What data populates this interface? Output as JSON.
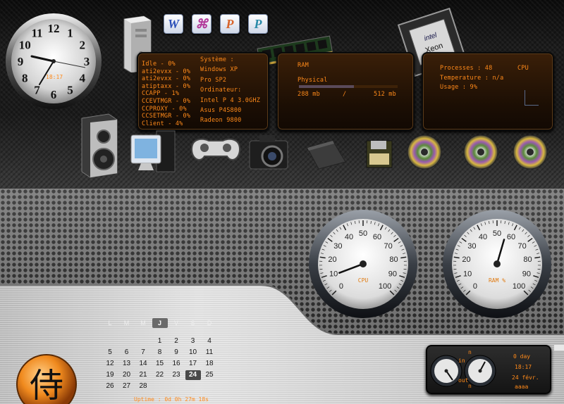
{
  "clock": {
    "time": "18:17",
    "numerals": [
      "12",
      "1",
      "2",
      "3",
      "4",
      "5",
      "6",
      "7",
      "8",
      "9",
      "10",
      "11"
    ]
  },
  "system_panel": {
    "processes": [
      "Idle - 0%",
      "ati2evxx - 0%",
      "ati2evxx - 0%",
      "atiptaxx - 0%",
      "CCAPP - 1%",
      "CCEVTMGR - 0%",
      "CCPROXY - 0%",
      "CCSETMGR - 0%",
      "Client - 4%"
    ],
    "system_info": [
      "Système :",
      "Windows XP",
      "Pro SP2",
      "Ordinateur:",
      "Intel P 4 3.0GHZ",
      "Asus P4S800",
      "Radeon 9800"
    ]
  },
  "ram_panel": {
    "title": "RAM",
    "label": "Physical",
    "used": "288 mb",
    "separator": "/",
    "total": "512 mb",
    "usage_fraction": 0.56
  },
  "cpu_panel": {
    "title": "CPU",
    "processes": "Processes : 48",
    "temperature": "Temperature : n/a",
    "usage": "Usage : 9%",
    "chip_brand": "intel",
    "chip_model": "Xeon"
  },
  "launcher": {
    "office_icons": [
      {
        "name": "word-icon",
        "glyph": "W",
        "color": "#2a4fb8"
      },
      {
        "name": "key-app-icon",
        "glyph": "⌘",
        "color": "#b23a9a"
      },
      {
        "name": "powerpoint-icon",
        "glyph": "P",
        "color": "#d8642a"
      },
      {
        "name": "publisher-icon",
        "glyph": "P",
        "color": "#2a8aa8"
      }
    ],
    "dock_icons": [
      "speaker-icon",
      "computer-icon",
      "gamepad-icon",
      "camera-icon",
      "folder-icon",
      "floppy-icon",
      "cd-icon",
      "cd-icon",
      "cd-icon"
    ]
  },
  "gauges": [
    {
      "label": "CPU",
      "ticks": [
        "0",
        "10",
        "20",
        "30",
        "40",
        "50",
        "60",
        "70",
        "80",
        "90",
        "100"
      ],
      "value": 9
    },
    {
      "label": "RAM %",
      "ticks": [
        "0",
        "10",
        "20",
        "30",
        "40",
        "50",
        "60",
        "70",
        "80",
        "90",
        "100"
      ],
      "value": 56
    }
  ],
  "calendar": {
    "day_headers": [
      "L",
      "M",
      "M",
      "J",
      "V",
      "S",
      "D"
    ],
    "highlight_header": 3,
    "weeks": [
      [
        "",
        "",
        "",
        "1",
        "2",
        "3",
        "4"
      ],
      [
        "5",
        "6",
        "7",
        "8",
        "9",
        "10",
        "11"
      ],
      [
        "12",
        "13",
        "14",
        "15",
        "16",
        "17",
        "18"
      ],
      [
        "19",
        "20",
        "21",
        "22",
        "23",
        "24",
        "25"
      ],
      [
        "26",
        "27",
        "28",
        "",
        "",
        "",
        ""
      ]
    ],
    "today": "24"
  },
  "uptime": "Uptime : 0d 0h 27m 18s",
  "network": {
    "in_label": "in",
    "out_label": "out",
    "days": "0 day",
    "time": "18:17",
    "date": "24 févr.",
    "year": "aaaa",
    "small_top": "n",
    "small_bottom": "n"
  },
  "logo": {
    "glyph": "侍"
  }
}
